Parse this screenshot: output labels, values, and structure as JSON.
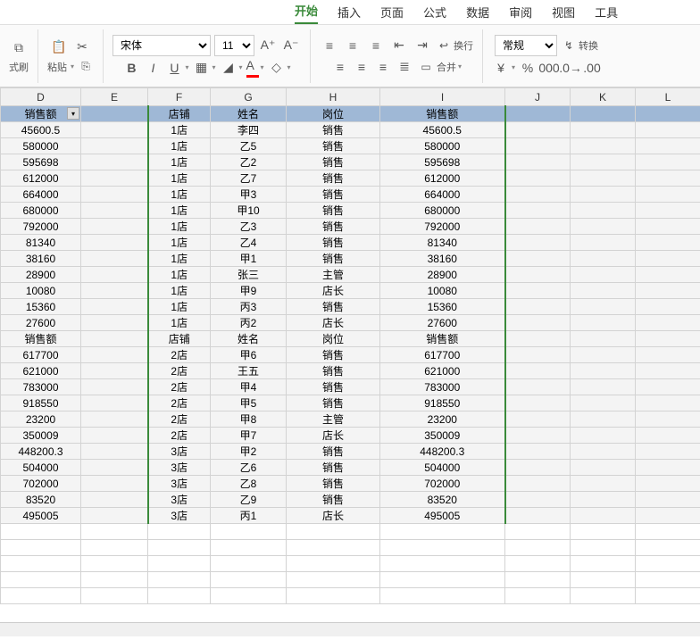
{
  "tabs": {
    "items": [
      "开始",
      "插入",
      "页面",
      "公式",
      "数据",
      "审阅",
      "视图",
      "工具"
    ],
    "active": 0
  },
  "toolbar": {
    "format_painter_label": "式刷",
    "paste_label": "粘贴",
    "font_name": "宋体",
    "font_size": "11",
    "bold": "B",
    "italic": "I",
    "underline": "U",
    "wrap_label": "换行",
    "merge_label": "合并",
    "number_format": "常规",
    "transform_label": "转换"
  },
  "column_headers": [
    "D",
    "E",
    "F",
    "G",
    "H",
    "I",
    "J",
    "K",
    "L"
  ],
  "col_d": {
    "header": "销售额",
    "values": [
      "45600.5",
      "580000",
      "595698",
      "612000",
      "664000",
      "680000",
      "792000",
      "81340",
      "38160",
      "28900",
      "10080",
      "15360",
      "27600",
      "销售额",
      "617700",
      "621000",
      "783000",
      "918550",
      "23200",
      "350009",
      "448200.3",
      "504000",
      "702000",
      "83520",
      "495005"
    ]
  },
  "table_block": {
    "headers": [
      "店铺",
      "姓名",
      "岗位",
      "销售额"
    ],
    "rows_1": [
      [
        "1店",
        "李四",
        "销售",
        "45600.5"
      ],
      [
        "1店",
        "乙5",
        "销售",
        "580000"
      ],
      [
        "1店",
        "乙2",
        "销售",
        "595698"
      ],
      [
        "1店",
        "乙7",
        "销售",
        "612000"
      ],
      [
        "1店",
        "甲3",
        "销售",
        "664000"
      ],
      [
        "1店",
        "甲10",
        "销售",
        "680000"
      ],
      [
        "1店",
        "乙3",
        "销售",
        "792000"
      ],
      [
        "1店",
        "乙4",
        "销售",
        "81340"
      ],
      [
        "1店",
        "甲1",
        "销售",
        "38160"
      ],
      [
        "1店",
        "张三",
        "主管",
        "28900"
      ],
      [
        "1店",
        "甲9",
        "店长",
        "10080"
      ],
      [
        "1店",
        "丙3",
        "销售",
        "15360"
      ],
      [
        "1店",
        "丙2",
        "店长",
        "27600"
      ]
    ],
    "mid_headers": [
      "店铺",
      "姓名",
      "岗位",
      "销售额"
    ],
    "rows_2": [
      [
        "2店",
        "甲6",
        "销售",
        "617700"
      ],
      [
        "2店",
        "王五",
        "销售",
        "621000"
      ],
      [
        "2店",
        "甲4",
        "销售",
        "783000"
      ],
      [
        "2店",
        "甲5",
        "销售",
        "918550"
      ],
      [
        "2店",
        "甲8",
        "主管",
        "23200"
      ],
      [
        "2店",
        "甲7",
        "店长",
        "350009"
      ],
      [
        "3店",
        "甲2",
        "销售",
        "448200.3"
      ],
      [
        "3店",
        "乙6",
        "销售",
        "504000"
      ],
      [
        "3店",
        "乙8",
        "销售",
        "702000"
      ],
      [
        "3店",
        "乙9",
        "销售",
        "83520"
      ],
      [
        "3店",
        "丙1",
        "店长",
        "495005"
      ]
    ]
  }
}
